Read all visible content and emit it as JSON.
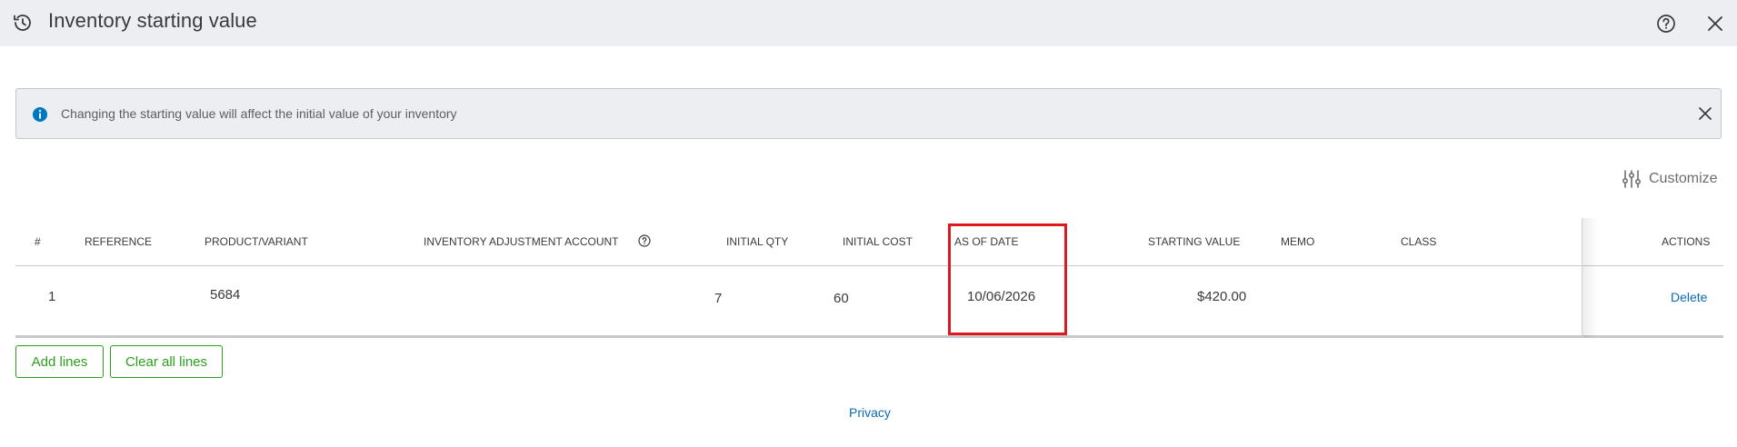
{
  "header": {
    "title": "Inventory starting value",
    "history_icon": "history-icon",
    "help_icon": "help-circle-icon",
    "close_icon": "close-icon"
  },
  "banner": {
    "text": "Changing the starting value will affect the initial value of your inventory",
    "info_icon": "info-icon",
    "close_icon": "close-icon"
  },
  "toolbar": {
    "customize_label": "Customize",
    "customize_icon": "sliders-icon"
  },
  "table": {
    "columns": [
      "#",
      "REFERENCE",
      "PRODUCT/VARIANT",
      "INVENTORY ADJUSTMENT ACCOUNT",
      "INITIAL QTY",
      "INITIAL COST",
      "AS OF DATE",
      "STARTING VALUE",
      "MEMO",
      "CLASS",
      "ACTIONS"
    ],
    "rows": [
      {
        "num": "1",
        "reference": "",
        "product": "5684",
        "account": "",
        "initial_qty": "7",
        "initial_cost": "60",
        "as_of_date": "10/06/2026",
        "starting_value": "$420.00",
        "memo": "",
        "class": "",
        "action": "Delete"
      }
    ]
  },
  "buttons": {
    "add_lines": "Add lines",
    "clear_all_lines": "Clear all lines"
  },
  "footer": {
    "privacy": "Privacy"
  },
  "colors": {
    "header_bg": "#eceef1",
    "accent_green": "#2ca01c",
    "link_blue": "#0d6ab4",
    "info_blue": "#0077c5",
    "highlight_red": "#e0171e"
  }
}
